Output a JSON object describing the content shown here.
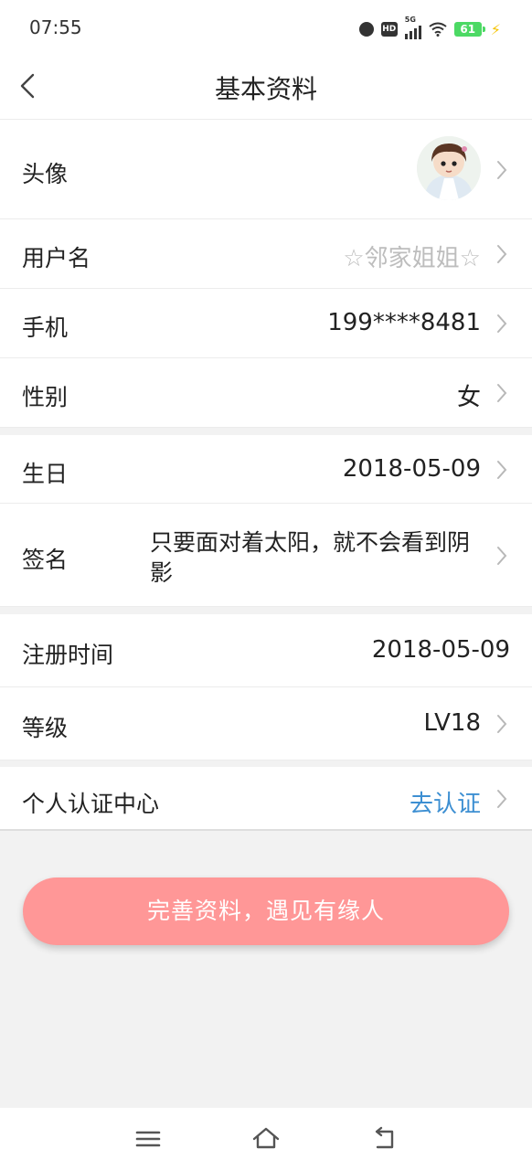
{
  "status_bar": {
    "time": "07:55",
    "signal": "5G",
    "hd": "HD",
    "battery": "61"
  },
  "header": {
    "title": "基本资料"
  },
  "profile": {
    "avatar_label": "头像",
    "username_label": "用户名",
    "username_value": "☆邻家姐姐☆",
    "phone_label": "手机",
    "phone_value": "199****8481",
    "gender_label": "性别",
    "gender_value": "女",
    "birthday_label": "生日",
    "birthday_value": "2018-05-09",
    "signature_label": "签名",
    "signature_value": "只要面对着太阳，就不会看到阴影",
    "register_label": "注册时间",
    "register_value": "2018-05-09",
    "level_label": "等级",
    "level_value": "LV18",
    "verify_label": "个人认证中心",
    "verify_value": "去认证"
  },
  "cta": {
    "label": "完善资料，遇见有缘人"
  },
  "colors": {
    "accent_button": "#ff9797",
    "link": "#3d8fd2",
    "muted": "#bdbdbd",
    "background": "#f2f2f2"
  }
}
